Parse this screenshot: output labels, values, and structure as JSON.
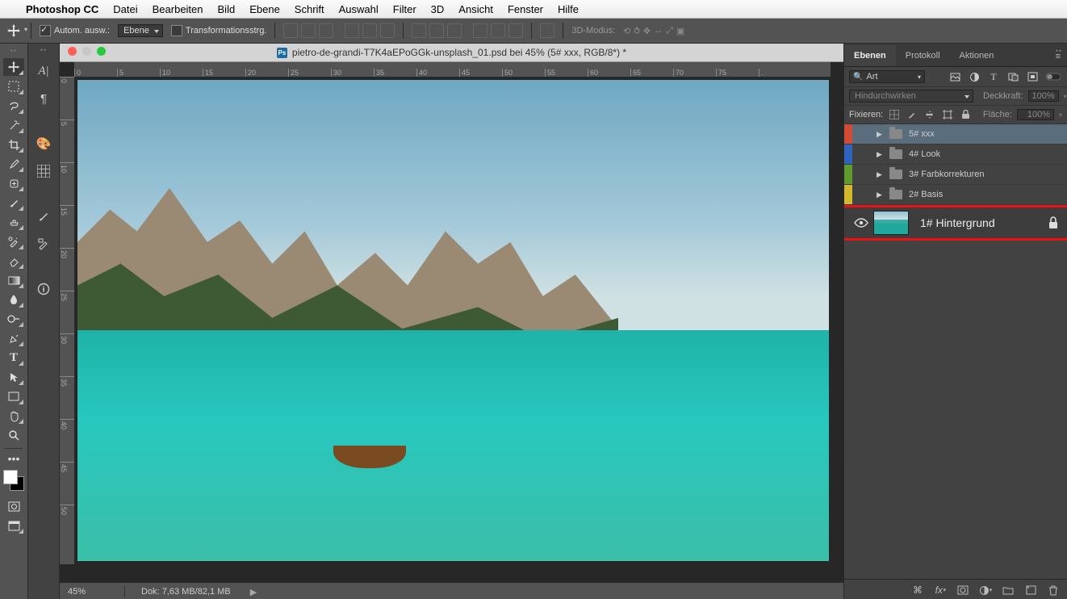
{
  "menubar": {
    "app": "Photoshop CC",
    "items": [
      "Datei",
      "Bearbeiten",
      "Bild",
      "Ebene",
      "Schrift",
      "Auswahl",
      "Filter",
      "3D",
      "Ansicht",
      "Fenster",
      "Hilfe"
    ]
  },
  "options": {
    "auto_select_label": "Autom. ausw.:",
    "auto_select_mode": "Ebene",
    "transform_controls_label": "Transformationsstrg.",
    "mode3d_label": "3D-Modus:"
  },
  "document": {
    "title": "pietro-de-grandi-T7K4aEPoGGk-unsplash_01.psd bei 45% (5# xxx, RGB/8*) *",
    "ruler_h": [
      "0",
      "5",
      "10",
      "15",
      "20",
      "25",
      "30",
      "35",
      "40",
      "45",
      "50",
      "55",
      "60",
      "65",
      "70",
      "75",
      "."
    ],
    "ruler_v": [
      "0",
      "5",
      "10",
      "15",
      "20",
      "25",
      "30",
      "35",
      "40",
      "45",
      "50"
    ]
  },
  "status": {
    "zoom": "45%",
    "docsize_label": "Dok:",
    "docsize": "7,63 MB/82,1 MB"
  },
  "panels": {
    "tabs": {
      "layers": "Ebenen",
      "history": "Protokoll",
      "actions": "Aktionen"
    },
    "filter_kind": "Art",
    "blend_mode": "Hindurchwirken",
    "opacity_label": "Deckkraft:",
    "opacity": "100%",
    "lock_label": "Fixieren:",
    "fill_label": "Fläche:",
    "fill": "100%",
    "groups": [
      {
        "color": "#d24b37",
        "name": "5# xxx",
        "selected": true
      },
      {
        "color": "#2f63c0",
        "name": "4# Look",
        "selected": false
      },
      {
        "color": "#5f9a2e",
        "name": "3# Farbkorrekturen",
        "selected": false
      },
      {
        "color": "#d4b82c",
        "name": "2# Basis",
        "selected": false
      }
    ],
    "background_layer": {
      "name": "1# Hintergrund"
    }
  }
}
